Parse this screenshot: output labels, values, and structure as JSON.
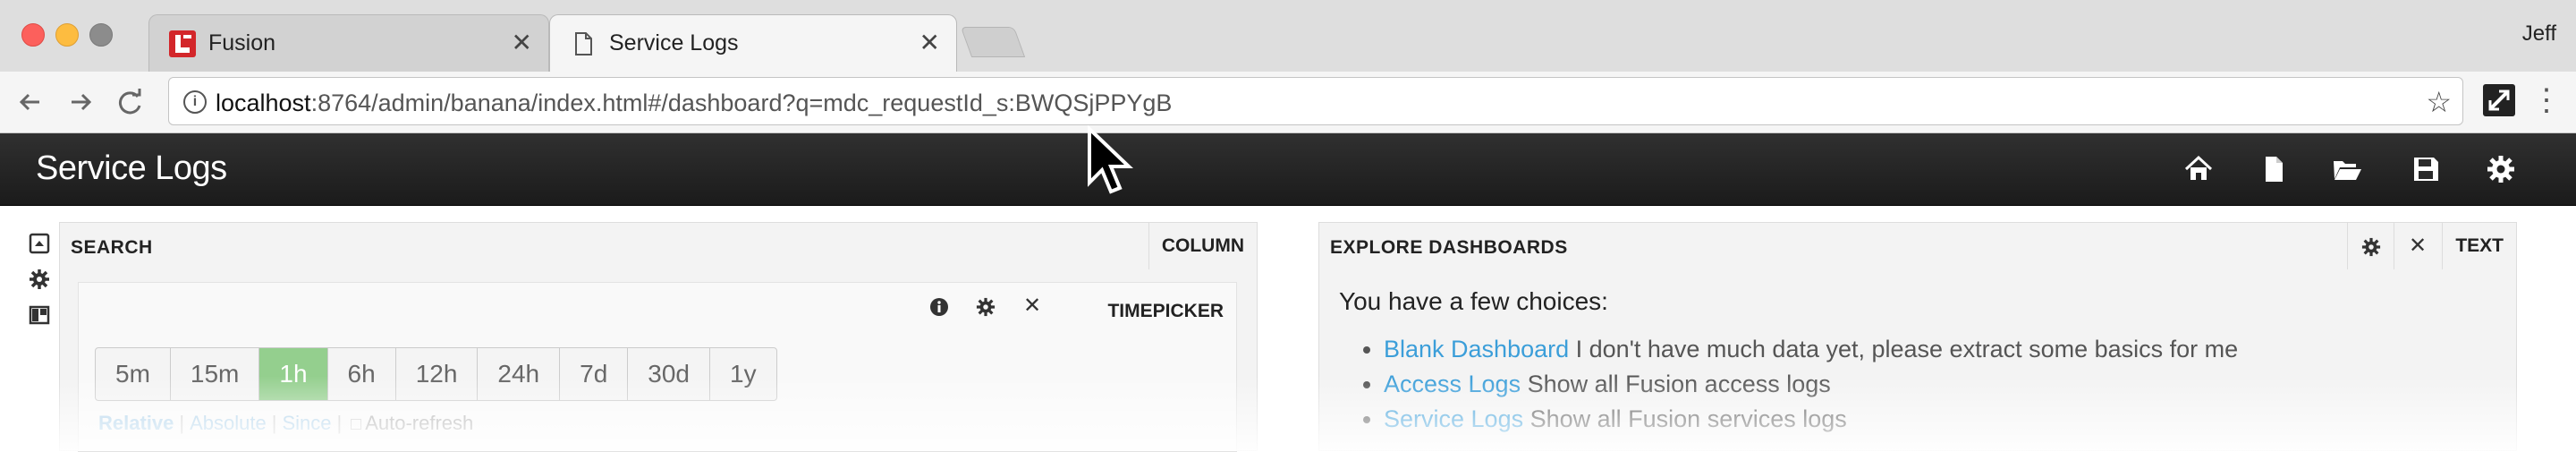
{
  "browser": {
    "tabs": [
      {
        "label": "Fusion",
        "active": false
      },
      {
        "label": "Service Logs",
        "active": true
      }
    ],
    "profile_name": "Jeff",
    "url_host": "localhost",
    "url_rest": ":8764/admin/banana/index.html#/dashboard?q=mdc_requestId_s:BWQSjPPYgB",
    "icons": {
      "back": "back-arrow-icon",
      "forward": "forward-arrow-icon",
      "reload": "reload-icon",
      "info": "info-icon",
      "bookmark": "star-icon",
      "extension": "extension-icon",
      "menu": "menu-dots-icon"
    }
  },
  "app": {
    "title": "Service Logs",
    "nav_icons": [
      "home-icon",
      "new-file-icon",
      "open-folder-icon",
      "save-icon",
      "gear-icon"
    ],
    "side_icons": [
      "collapse-icon",
      "gear-icon",
      "layout-icon"
    ]
  },
  "search_panel": {
    "title": "SEARCH",
    "tag": "COLUMN",
    "timepicker": {
      "tag": "TIMEPICKER",
      "buttons": [
        "5m",
        "15m",
        "1h",
        "6h",
        "12h",
        "24h",
        "7d",
        "30d",
        "1y"
      ],
      "selected": "1h",
      "modes": {
        "relative": "Relative",
        "absolute": "Absolute",
        "since": "Since",
        "auto_refresh": "Auto-refresh"
      }
    }
  },
  "explore_panel": {
    "title": "EXPLORE DASHBOARDS",
    "tag": "TEXT",
    "intro": "You have a few choices:",
    "items": [
      {
        "link": "Blank Dashboard",
        "text": " I don't have much data yet, please extract some basics for me"
      },
      {
        "link": "Access Logs",
        "text": " Show all Fusion access logs"
      },
      {
        "link": "Service Logs",
        "text": " Show all Fusion services logs"
      }
    ]
  },
  "colors": {
    "appbar": "#222222",
    "active_time": "#94cf8e",
    "link": "#3b9ed9"
  }
}
